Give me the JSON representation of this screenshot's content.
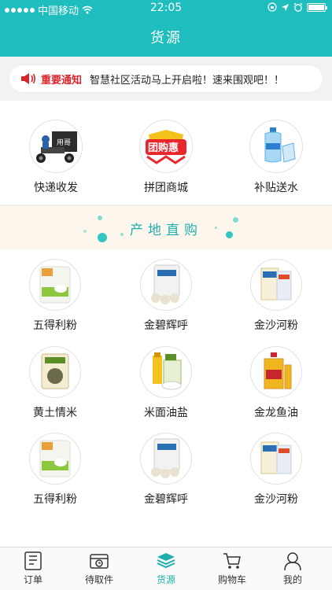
{
  "status": {
    "carrier": "中国移动",
    "time": "22:05"
  },
  "header": {
    "title": "货源"
  },
  "notice": {
    "tag": "重要通知",
    "message": "智慧社区活动马上开启啦！速来围观吧！！"
  },
  "services": [
    {
      "label": "快递收发",
      "icon": "delivery-tricycle-icon"
    },
    {
      "label": "拼团商城",
      "icon": "group-buy-icon"
    },
    {
      "label": "补贴送水",
      "icon": "water-bottle-icon"
    }
  ],
  "origin": {
    "title": "产地直购"
  },
  "products": [
    {
      "label": "五得利粉",
      "icon": "flour-bag-icon"
    },
    {
      "label": "金碧辉呼",
      "icon": "flour-sack-icon"
    },
    {
      "label": "金沙河粉",
      "icon": "flour-package-icon"
    },
    {
      "label": "黄土情米",
      "icon": "millet-bag-icon"
    },
    {
      "label": "米面油盐",
      "icon": "grocery-set-icon"
    },
    {
      "label": "金龙鱼油",
      "icon": "oil-bottle-icon"
    },
    {
      "label": "五得利粉",
      "icon": "flour-bag-icon"
    },
    {
      "label": "金碧辉呼",
      "icon": "flour-sack-icon"
    },
    {
      "label": "金沙河粉",
      "icon": "flour-package-icon"
    }
  ],
  "tabbar": [
    {
      "label": "订单",
      "icon": "order-icon"
    },
    {
      "label": "待取件",
      "icon": "pickup-icon"
    },
    {
      "label": "货源",
      "icon": "layers-icon"
    },
    {
      "label": "购物车",
      "icon": "cart-icon"
    },
    {
      "label": "我的",
      "icon": "user-icon"
    }
  ],
  "colors": {
    "brand": "#1fbdbd",
    "notice_tag": "#d8262d",
    "origin_bg": "#fdf6ec"
  }
}
